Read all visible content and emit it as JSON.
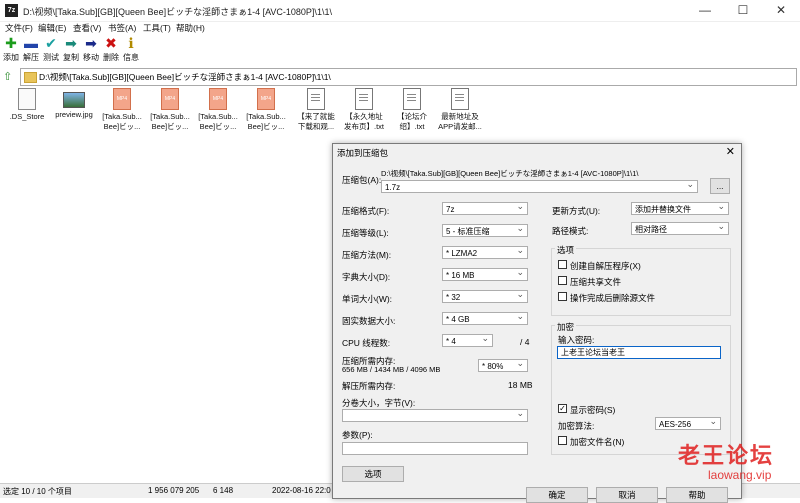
{
  "window": {
    "title": "D:\\视频\\[Taka.Sub][GB][Queen Bee]ビッチな淫師さまぁ1-4 [AVC-1080P]\\1\\1\\",
    "app_icon": "7z",
    "min": "—",
    "max": "☐",
    "close": "✕"
  },
  "menu": [
    "文件(F)",
    "编辑(E)",
    "查看(V)",
    "书签(A)",
    "工具(T)",
    "帮助(H)"
  ],
  "toolbar": [
    {
      "label": "添加",
      "glyph": "✚",
      "color": "#1c9c1c",
      "icon": "add-icon"
    },
    {
      "label": "解压",
      "glyph": "▬",
      "color": "#2244aa",
      "icon": "extract-icon"
    },
    {
      "label": "测试",
      "glyph": "✔",
      "color": "#1aa0a0",
      "icon": "test-icon"
    },
    {
      "label": "复制",
      "glyph": "➡",
      "color": "#1a8a7a",
      "icon": "copy-icon"
    },
    {
      "label": "移动",
      "glyph": "➡",
      "color": "#1a2a8a",
      "icon": "move-icon"
    },
    {
      "label": "删除",
      "glyph": "✖",
      "color": "#cc1111",
      "icon": "delete-icon"
    },
    {
      "label": "信息",
      "glyph": "ℹ",
      "color": "#b08a00",
      "icon": "info-icon"
    }
  ],
  "address": "D:\\视频\\[Taka.Sub][GB][Queen Bee]ビッチな淫師さまぁ1-4 [AVC-1080P]\\1\\1\\",
  "files": [
    {
      "name1": ".DS_Store",
      "name2": "",
      "type": "doc"
    },
    {
      "name1": "preview.jpg",
      "name2": "",
      "type": "img"
    },
    {
      "name1": "[Taka.Sub...",
      "name2": "Bee]ビッ...",
      "type": "mp4"
    },
    {
      "name1": "[Taka.Sub...",
      "name2": "Bee]ビッ...",
      "type": "mp4"
    },
    {
      "name1": "[Taka.Sub...",
      "name2": "Bee]ビッ...",
      "type": "mp4"
    },
    {
      "name1": "[Taka.Sub...",
      "name2": "Bee]ビッ...",
      "type": "mp4"
    },
    {
      "name1": "【来了就能",
      "name2": "下载和观...",
      "type": "txt"
    },
    {
      "name1": "【永久地址",
      "name2": "发布页】.txt",
      "type": "txt"
    },
    {
      "name1": "【论坛介",
      "name2": "绍】.txt",
      "type": "txt"
    },
    {
      "name1": "最新地址及",
      "name2": "APP请发邮...",
      "type": "txt"
    }
  ],
  "mp4_badge": "MP4",
  "status": [
    "选定 10 / 10 个项目",
    "1 956 079 205",
    "6 148",
    "2022-08-16 22:0"
  ],
  "dialog": {
    "title": "添加到压缩包",
    "close": "✕",
    "archive_label": "压缩包(A):",
    "archive_path": "D:\\视频\\[Taka.Sub][GB][Queen Bee]ビッチな淫師さまぁ1-4 [AVC-1080P]\\1\\1\\",
    "archive_name": "1.7z",
    "browse": "...",
    "format_label": "压缩格式(F):",
    "format_value": "7z",
    "level_label": "压缩等级(L):",
    "level_value": "5 - 标准压缩",
    "method_label": "压缩方法(M):",
    "method_value": "* LZMA2",
    "dict_label": "字典大小(D):",
    "dict_value": "* 16 MB",
    "word_label": "单词大小(W):",
    "word_value": "* 32",
    "solid_label": "固实数据大小:",
    "solid_value": "* 4 GB",
    "cpu_label": "CPU 线程数:",
    "cpu_value": "* 4",
    "cpu_total": "/ 4",
    "mem_comp_label": "压缩所需内存:",
    "mem_comp_detail": "656 MB / 1434 MB / 4096 MB",
    "mem_comp_value": "* 80%",
    "mem_decomp_label": "解压所需内存:",
    "mem_decomp_value": "18 MB",
    "split_label": "分卷大小，字节(V):",
    "params_label": "参数(P):",
    "options_button": "选项",
    "update_label": "更新方式(U):",
    "update_value": "添加并替换文件",
    "path_label": "路径模式:",
    "path_value": "相对路径",
    "options_group": "选项",
    "opt_sfx": "创建自解压程序(X)",
    "opt_shared": "压缩共享文件",
    "opt_delete": "操作完成后删除源文件",
    "encrypt_group": "加密",
    "password_label": "输入密码:",
    "password_value": "上老王论坛当老王",
    "show_password": "显示密码(S)",
    "enc_method_label": "加密算法:",
    "enc_method_value": "AES-256",
    "encrypt_names": "加密文件名(N)",
    "ok": "确定",
    "cancel": "取消",
    "help": "帮助"
  },
  "watermark": {
    "text": "老王论坛",
    "url": "laowang.vip"
  }
}
